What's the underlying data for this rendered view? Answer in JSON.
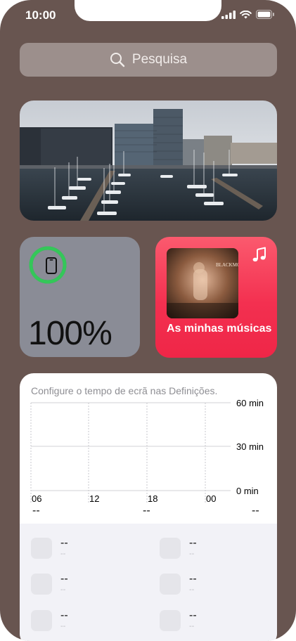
{
  "status_bar": {
    "time": "10:00"
  },
  "search": {
    "label": "Pesquisa"
  },
  "battery_widget": {
    "percentage": "100%",
    "level": 1.0,
    "ring_color": "#34c759"
  },
  "music_widget": {
    "title": "As minhas músicas",
    "album_text": "BLACKMORE"
  },
  "screen_time": {
    "message": "Configure o tempo de ecrã nas Definições.",
    "y_ticks": [
      "60 min",
      "30 min",
      "0 min"
    ],
    "x_ticks": [
      "06",
      "12",
      "18",
      "00"
    ],
    "summary": [
      "--",
      "--",
      "--"
    ],
    "apps": [
      {
        "name": "--",
        "time": "--"
      },
      {
        "name": "--",
        "time": "--"
      },
      {
        "name": "--",
        "time": "--"
      },
      {
        "name": "--",
        "time": "--"
      },
      {
        "name": "--",
        "time": "--"
      },
      {
        "name": "--",
        "time": "--"
      }
    ]
  }
}
